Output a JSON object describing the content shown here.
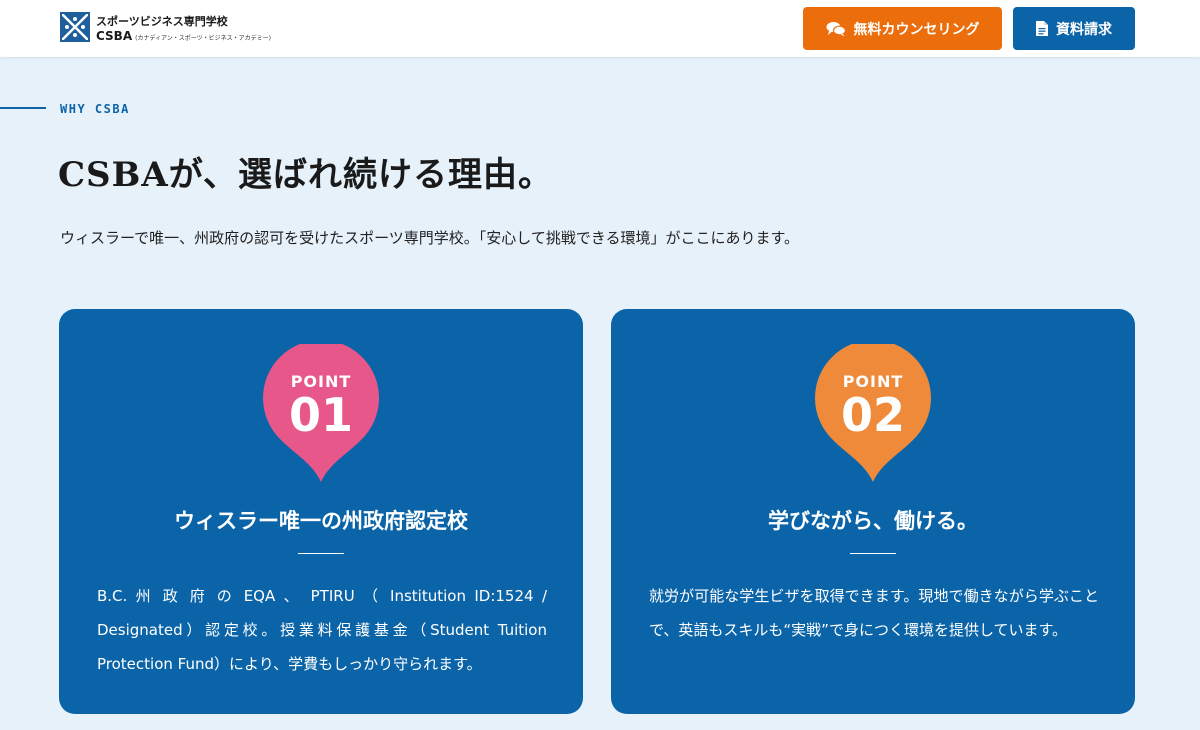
{
  "header": {
    "brand_top": "スポーツビジネス専門学校",
    "brand_main": "CSBA",
    "brand_sub": "(カナディアン・スポーツ・ビジネス・アカデミー)",
    "counsel_button": "無料カウンセリング",
    "document_button": "資料請求",
    "counsel_icon": "chat-bubbles-icon",
    "document_icon": "document-icon"
  },
  "section": {
    "label": "WHY CSBA",
    "heading": "CSBAが、選ばれ続ける理由。",
    "lead": "ウィスラーで唯一、州政府の認可を受けたスポーツ専門学校。「安心して挑戦できる環境」がここにあります。"
  },
  "points": [
    {
      "badge_label": "POINT",
      "number": "01",
      "color": "#e8578a",
      "title": "ウィスラー唯一の州政府認定校",
      "body": "B.C. 州 政 府 の EQA 、 PTIRU （ Institution ID:1524 / Designated）認定校。授業料保護基金（Student Tuition Protection Fund）により、学費もしっかり守られます。"
    },
    {
      "badge_label": "POINT",
      "number": "02",
      "color": "#ef8a3a",
      "title": "学びながら、働ける。",
      "body": "就労が可能な学生ビザを取得できます。現地で働きながら学ぶことで、英語もスキルも“実戦”で身につく環境を提供しています。"
    }
  ],
  "colors": {
    "brand_blue": "#0b64a8",
    "accent_orange": "#ec6d0b",
    "background": "#e6f1fa"
  }
}
